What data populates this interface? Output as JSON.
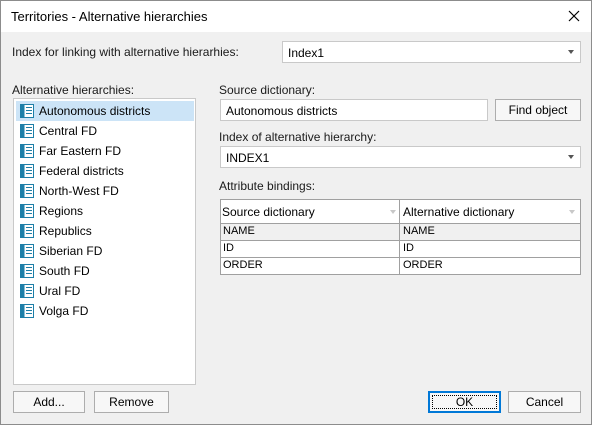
{
  "window": {
    "title": "Territories - Alternative hierarchies"
  },
  "index_link": {
    "label": "Index for linking with alternative hierarhies:",
    "value": "Index1"
  },
  "alt_hierarchies": {
    "label": "Alternative hierarchies:",
    "items": [
      {
        "label": "Autonomous districts",
        "selected": true
      },
      {
        "label": "Central FD"
      },
      {
        "label": "Far Eastern FD"
      },
      {
        "label": "Federal districts"
      },
      {
        "label": "North-West FD"
      },
      {
        "label": "Regions"
      },
      {
        "label": "Republics"
      },
      {
        "label": "Siberian FD"
      },
      {
        "label": "South FD"
      },
      {
        "label": "Ural FD"
      },
      {
        "label": "Volga FD"
      }
    ],
    "add_label": "Add...",
    "remove_label": "Remove"
  },
  "source_dictionary": {
    "label": "Source dictionary:",
    "value": "Autonomous districts",
    "find_label": "Find object"
  },
  "alt_index": {
    "label": "Index of alternative hierarchy:",
    "value": "INDEX1"
  },
  "bindings": {
    "label": "Attribute bindings:",
    "columns": [
      "Source dictionary",
      "Alternative dictionary"
    ],
    "rows": [
      [
        "NAME",
        "NAME"
      ],
      [
        "ID",
        "ID"
      ],
      [
        "ORDER",
        "ORDER"
      ]
    ]
  },
  "footer": {
    "ok_label": "OK",
    "cancel_label": "Cancel"
  },
  "colors": {
    "selection": "#cce4f7",
    "accent": "#0078d7",
    "icon": "#1e7fa8"
  },
  "icons": {
    "close": "close-icon",
    "dictionary": "dictionary-icon",
    "dropdown": "chevron-down-icon"
  }
}
